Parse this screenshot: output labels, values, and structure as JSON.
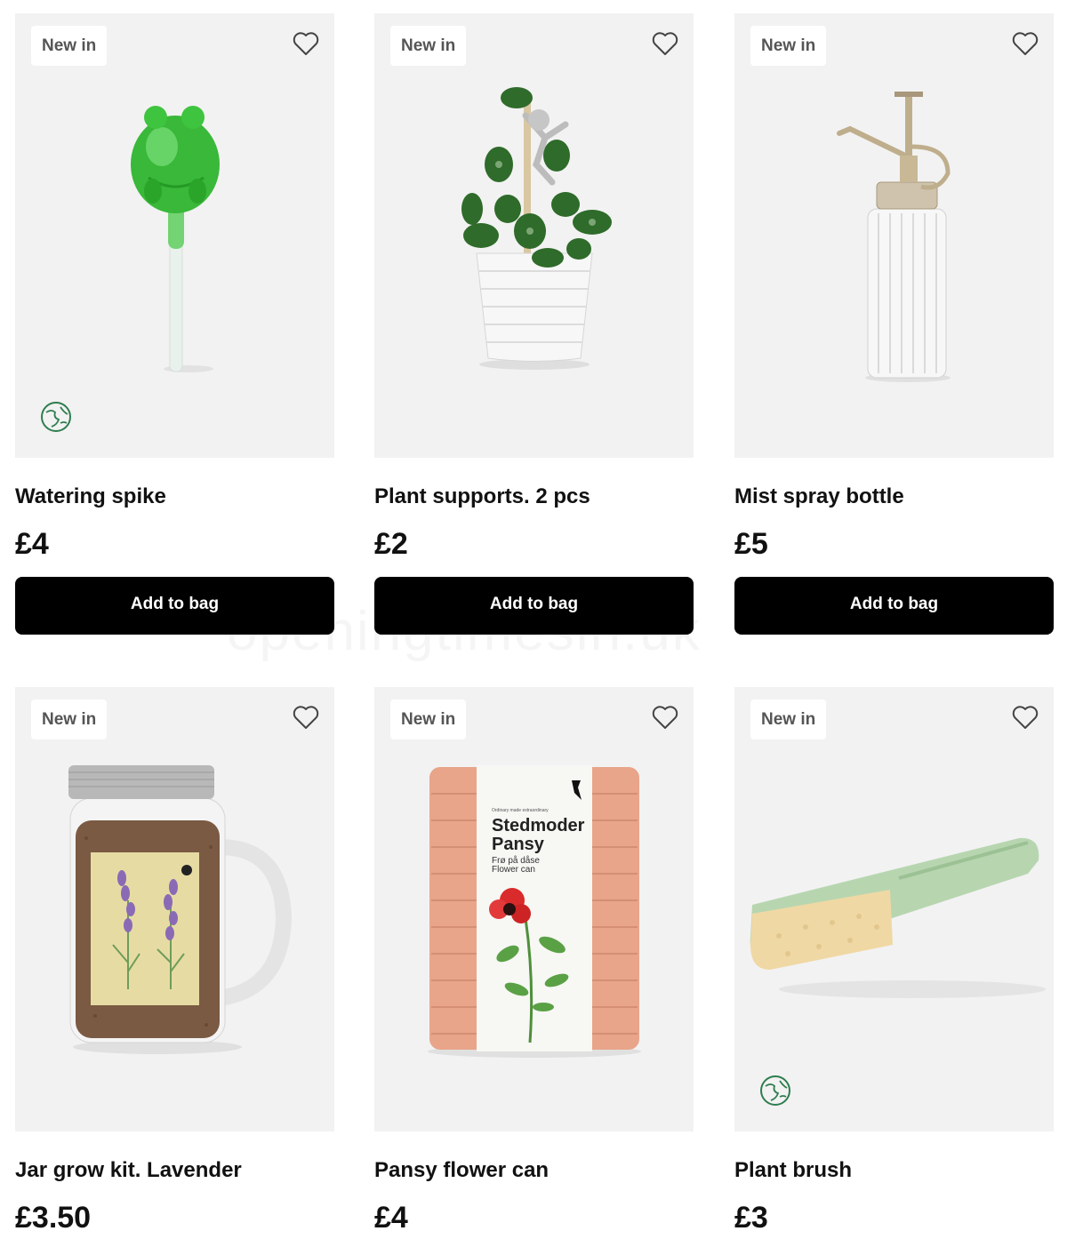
{
  "products": [
    {
      "badge": "New in",
      "title": "Watering spike",
      "price": "£4",
      "button": "Add to bag",
      "eco": true
    },
    {
      "badge": "New in",
      "title": "Plant supports. 2 pcs",
      "price": "£2",
      "button": "Add to bag",
      "eco": false
    },
    {
      "badge": "New in",
      "title": "Mist spray bottle",
      "price": "£5",
      "button": "Add to bag",
      "eco": false
    },
    {
      "badge": "New in",
      "title": "Jar grow kit. Lavender",
      "price": "£3.50",
      "button": null,
      "eco": false
    },
    {
      "badge": "New in",
      "title": "Pansy flower can",
      "price": "£4",
      "button": null,
      "eco": false,
      "can_label": {
        "small": "Ordinary made extraordinary",
        "name_line1": "Stedmoder",
        "name_line2": "Pansy",
        "sub_line1": "Frø på dåse",
        "sub_line2": "Flower can"
      }
    },
    {
      "badge": "New in",
      "title": "Plant brush",
      "price": "£3",
      "button": null,
      "eco": true
    }
  ],
  "watermark": "openingtimesin.uk",
  "icons": {
    "wishlist": "heart-outline-icon",
    "eco": "globe-leaf-icon"
  },
  "colors": {
    "button": "#000000",
    "card_bg": "#f2f2f2",
    "eco_green": "#2e7d4f"
  }
}
